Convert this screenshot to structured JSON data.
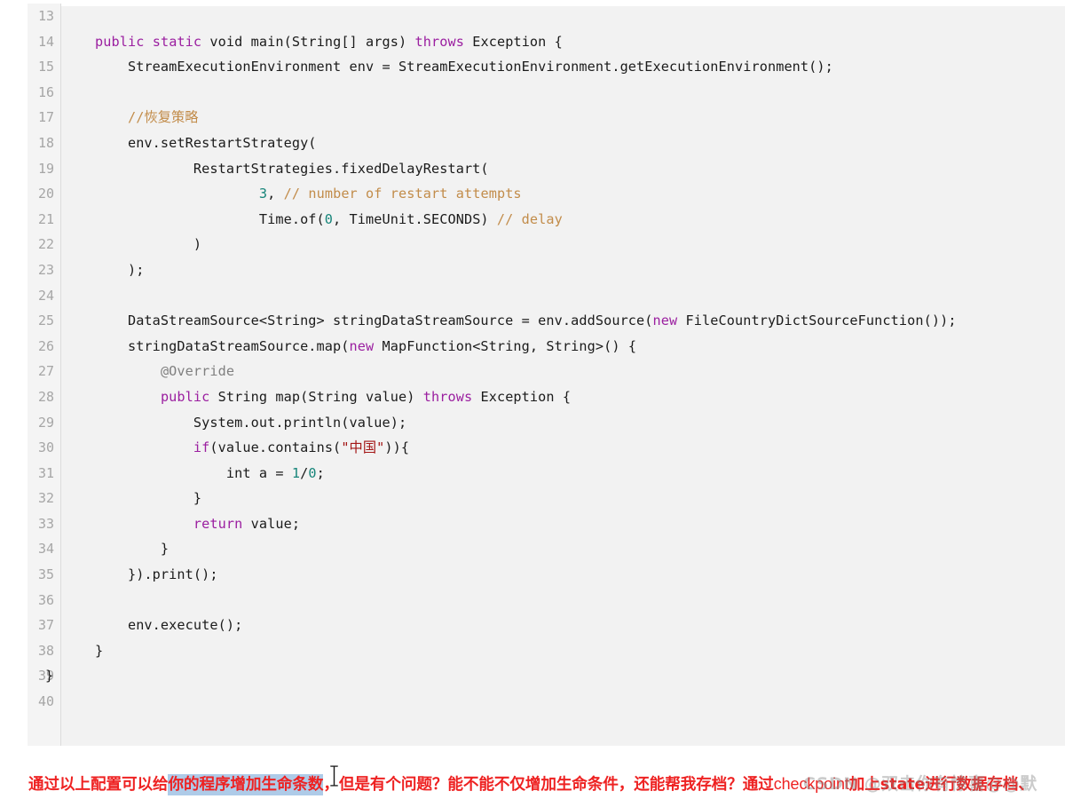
{
  "editor": {
    "language": "java",
    "first_line_number": 13,
    "last_line_number": 40,
    "background_color": "#f2f2f2",
    "gutter_color": "#f4f4f4",
    "line_number_color": "#a6a6a6",
    "token_colors": {
      "keyword": "#9b1fa0",
      "number": "#17857a",
      "comment": "#c28c4a",
      "string": "#a31515",
      "annotation": "#808080",
      "plain": "#1b1b1b"
    },
    "lines": [
      {
        "n": "13",
        "tokens": []
      },
      {
        "n": "14",
        "tokens": [
          {
            "t": "    ",
            "c": "pl"
          },
          {
            "t": "public",
            "c": "kw"
          },
          {
            "t": " ",
            "c": "pl"
          },
          {
            "t": "static",
            "c": "kw"
          },
          {
            "t": " void main(String[] args) ",
            "c": "pl"
          },
          {
            "t": "throws",
            "c": "kw"
          },
          {
            "t": " Exception {",
            "c": "pl"
          }
        ]
      },
      {
        "n": "15",
        "tokens": [
          {
            "t": "        StreamExecutionEnvironment env = StreamExecutionEnvironment.getExecutionEnvironment();",
            "c": "pl"
          }
        ]
      },
      {
        "n": "16",
        "tokens": []
      },
      {
        "n": "17",
        "tokens": [
          {
            "t": "        ",
            "c": "pl"
          },
          {
            "t": "//恢复策略",
            "c": "cmt"
          }
        ]
      },
      {
        "n": "18",
        "tokens": [
          {
            "t": "        env.setRestartStrategy(",
            "c": "pl"
          }
        ]
      },
      {
        "n": "19",
        "tokens": [
          {
            "t": "                RestartStrategies.fixedDelayRestart(",
            "c": "pl"
          }
        ]
      },
      {
        "n": "20",
        "tokens": [
          {
            "t": "                        ",
            "c": "pl"
          },
          {
            "t": "3",
            "c": "num"
          },
          {
            "t": ", ",
            "c": "pl"
          },
          {
            "t": "// number of restart attempts",
            "c": "cmt"
          }
        ]
      },
      {
        "n": "21",
        "tokens": [
          {
            "t": "                        Time.of(",
            "c": "pl"
          },
          {
            "t": "0",
            "c": "num"
          },
          {
            "t": ", TimeUnit.SECONDS) ",
            "c": "pl"
          },
          {
            "t": "// delay",
            "c": "cmt"
          }
        ]
      },
      {
        "n": "22",
        "tokens": [
          {
            "t": "                )",
            "c": "pl"
          }
        ]
      },
      {
        "n": "23",
        "tokens": [
          {
            "t": "        );",
            "c": "pl"
          }
        ]
      },
      {
        "n": "24",
        "tokens": []
      },
      {
        "n": "25",
        "tokens": [
          {
            "t": "        DataStreamSource<String> stringDataStreamSource = env.addSource(",
            "c": "pl"
          },
          {
            "t": "new",
            "c": "kw"
          },
          {
            "t": " FileCountryDictSourceFunction());",
            "c": "pl"
          }
        ]
      },
      {
        "n": "26",
        "tokens": [
          {
            "t": "        stringDataStreamSource.map(",
            "c": "pl"
          },
          {
            "t": "new",
            "c": "kw"
          },
          {
            "t": " MapFunction<String, String>() {",
            "c": "pl"
          }
        ]
      },
      {
        "n": "27",
        "tokens": [
          {
            "t": "            ",
            "c": "pl"
          },
          {
            "t": "@Override",
            "c": "ann"
          }
        ]
      },
      {
        "n": "28",
        "tokens": [
          {
            "t": "            ",
            "c": "pl"
          },
          {
            "t": "public",
            "c": "kw"
          },
          {
            "t": " String map(String value) ",
            "c": "pl"
          },
          {
            "t": "throws",
            "c": "kw"
          },
          {
            "t": " Exception {",
            "c": "pl"
          }
        ]
      },
      {
        "n": "29",
        "tokens": [
          {
            "t": "                System.out.println(value);",
            "c": "pl"
          }
        ]
      },
      {
        "n": "30",
        "tokens": [
          {
            "t": "                ",
            "c": "pl"
          },
          {
            "t": "if",
            "c": "kw"
          },
          {
            "t": "(value.contains(",
            "c": "pl"
          },
          {
            "t": "\"中国\"",
            "c": "str"
          },
          {
            "t": ")){",
            "c": "pl"
          }
        ]
      },
      {
        "n": "31",
        "tokens": [
          {
            "t": "                    int a = ",
            "c": "pl"
          },
          {
            "t": "1",
            "c": "num"
          },
          {
            "t": "/",
            "c": "pl"
          },
          {
            "t": "0",
            "c": "num"
          },
          {
            "t": ";",
            "c": "pl"
          }
        ]
      },
      {
        "n": "32",
        "tokens": [
          {
            "t": "                }",
            "c": "pl"
          }
        ]
      },
      {
        "n": "33",
        "tokens": [
          {
            "t": "                ",
            "c": "pl"
          },
          {
            "t": "return",
            "c": "kw"
          },
          {
            "t": " value;",
            "c": "pl"
          }
        ]
      },
      {
        "n": "34",
        "tokens": [
          {
            "t": "            }",
            "c": "pl"
          }
        ]
      },
      {
        "n": "35",
        "tokens": [
          {
            "t": "        }).print();",
            "c": "pl"
          }
        ]
      },
      {
        "n": "36",
        "tokens": []
      },
      {
        "n": "37",
        "tokens": [
          {
            "t": "        env.execute();",
            "c": "pl"
          }
        ]
      },
      {
        "n": "38",
        "tokens": [
          {
            "t": "    }",
            "c": "pl"
          }
        ]
      },
      {
        "n": "39",
        "tokens": [
          {
            "t": "}",
            "c": "pl"
          }
        ],
        "outdent": true
      },
      {
        "n": "40",
        "tokens": []
      }
    ]
  },
  "caption": {
    "color": "#ee2222",
    "selection_color": "#aecbe8",
    "segments": [
      {
        "t": "通过以上配置可以给",
        "selected": false
      },
      {
        "t": "你的程序增加生命条数",
        "selected": true
      },
      {
        "t": "，但是有个问题？能不能不仅增加生命条件，还能帮我存档？通过",
        "selected": false
      },
      {
        "t": "checkpoint",
        "selected": false,
        "latin": true
      },
      {
        "t": "加上state进行数据存档、",
        "selected": false
      }
    ]
  },
  "watermark": {
    "text": "CSDN @双击你有惊喜@@默",
    "color": "rgba(130,130,130,0.42)"
  },
  "cursor": {
    "type": "i-beam-text-cursor"
  }
}
